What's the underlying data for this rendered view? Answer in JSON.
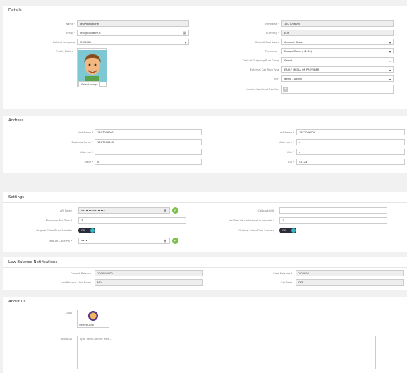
{
  "details": {
    "title": "Details",
    "name_label": "Name *",
    "name_value": "TestProduzione",
    "email_label": "Email *",
    "email_value": "test@cloudfire.it",
    "language_label": "Default Language",
    "language_value": "ENGLISH",
    "picture_label": "Profile Picture *",
    "select_image": "Select Image",
    "username_label": "Username *",
    "username_value": "18CT00600C",
    "currency_label": "Currency *",
    "currency_value": "EUR",
    "dashboard_label": "Default Dashboard",
    "dashboard_value": "Account Status",
    "timezone_label": "Timezone *",
    "timezone_value": "Europe/Rome (+1:00)",
    "outgoing_label": "Default Outgoing Rule Group",
    "outgoing_value": "Select",
    "ringtype_label": "External Call Ring Type",
    "ringtype_value": "EARLY MEDIA OF PROVIDER",
    "vmh_label": "VMH",
    "vmh_value": "demo - Admin",
    "invoice_label": "Invoice Recipient Email(s)"
  },
  "address": {
    "title": "Address",
    "first_label": "First Name *",
    "first_value": "18CT00600C",
    "business_label": "Business Name *",
    "business_value": "18CT00600C",
    "address2_label": "Address 2",
    "address2_value": "",
    "state_label": "State *",
    "state_value": "x",
    "last_label": "Last Name *",
    "last_value": "18CT00600C",
    "address1_label": "Address 1 *",
    "address1_value": "x",
    "city_label": "City *",
    "city_value": "x",
    "zip_label": "Zip *",
    "zip_value": "42124"
  },
  "settings": {
    "title": "Settings",
    "api_label": "API Token",
    "api_value": "••••••••••••••••",
    "fax_label": "Maximum Fax Tries *",
    "fax_value": "3",
    "callerid_label": "Original CallerID on Transfer",
    "callerid_toggle": "ON",
    "feature_label": "Feature Code Pin *",
    "feature_value": "••••",
    "callback_label": "Callback URL",
    "callback_value": "",
    "interval_label": "Fax Tries Pause Interval in seconds *",
    "interval_value": "1",
    "forward_label": "Original CallerID on Forward",
    "forward_toggle": "ON"
  },
  "low_balance": {
    "title": "Low Balance Notifications",
    "current_label": "Current Balance",
    "current_value": "1000.00000",
    "email_label": "Low Balance Alert Email",
    "email_value": "NO",
    "alert_label": "Alert Balance *",
    "alert_value": "1.00000",
    "call_label": "Call Alert",
    "call_value": "OFF"
  },
  "about": {
    "title": "About Us",
    "logo_label": "Logo",
    "select_logo": "Select Logo",
    "about_label": "About Us",
    "about_placeholder": "Type Your Content Here..."
  }
}
